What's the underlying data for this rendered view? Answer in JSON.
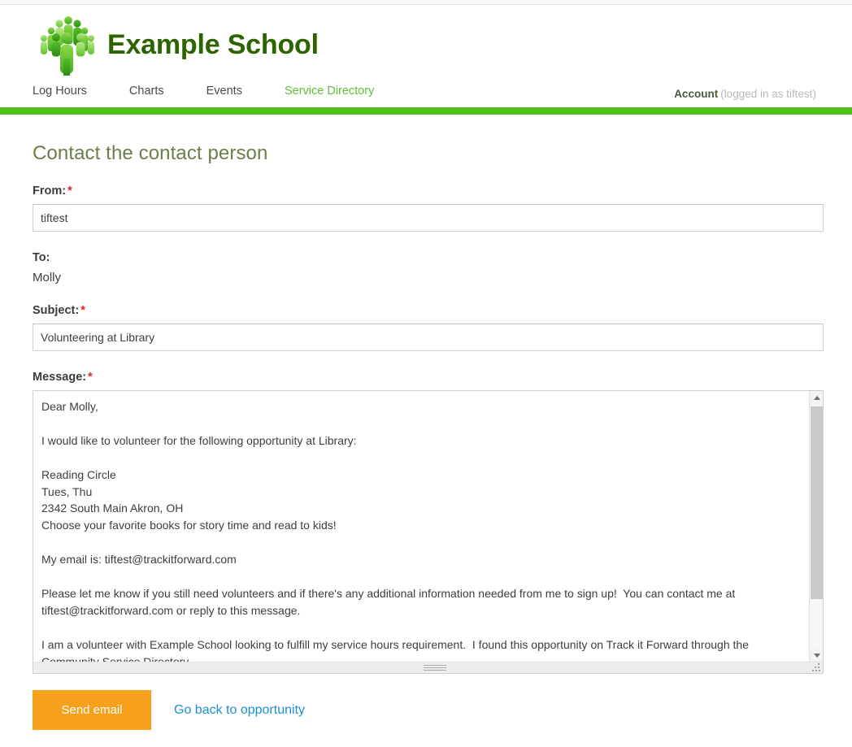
{
  "header": {
    "brand_title": "Example School",
    "logo_icon": "tree-people-logo",
    "nav": [
      {
        "label": "Log Hours",
        "active": false
      },
      {
        "label": "Charts",
        "active": false
      },
      {
        "label": "Events",
        "active": false
      },
      {
        "label": "Service Directory",
        "active": true
      }
    ],
    "account_label": "Account",
    "account_status": "(logged in as tiftest)",
    "accent_green": "#4fc11b",
    "brand_green": "#2d6400",
    "active_nav_green": "#5cc139"
  },
  "page": {
    "title": "Contact the contact person"
  },
  "form": {
    "from": {
      "label": "From:",
      "required_marker": "*",
      "value": "tiftest",
      "placeholder": ""
    },
    "to": {
      "label": "To:",
      "value": "Molly"
    },
    "subject": {
      "label": "Subject:",
      "required_marker": "*",
      "value": "Volunteering at Library",
      "placeholder": ""
    },
    "message": {
      "label": "Message:",
      "required_marker": "*",
      "value": "Dear Molly,\n\nI would like to volunteer for the following opportunity at Library:\n\nReading Circle\nTues, Thu\n2342 South Main Akron, OH\nChoose your favorite books for story time and read to kids!\n\nMy email is: tiftest@trackitforward.com\n\nPlease let me know if you still need volunteers and if there's any additional information needed from me to sign up!  You can contact me at tiftest@trackitforward.com or reply to this message.\n\nI am a volunteer with Example School looking to fulfill my service hours requirement.  I found this opportunity on Track it Forward through the Community Service Directory."
    }
  },
  "actions": {
    "send_label": "Send email",
    "send_color": "#f7a01c",
    "back_label": "Go back to opportunity",
    "back_color": "#1b8fd4"
  }
}
